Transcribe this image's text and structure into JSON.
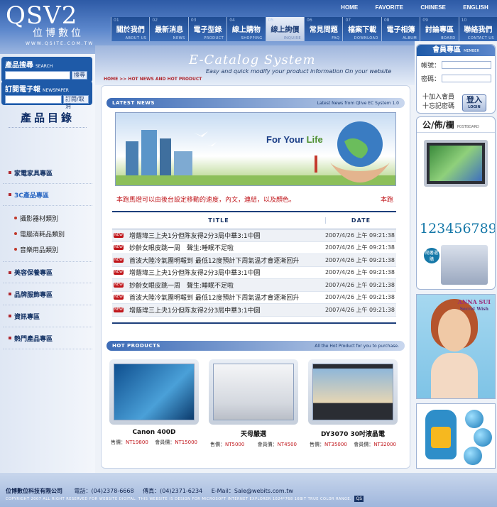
{
  "brand": {
    "logo": "QSV2",
    "logo_cn": "位博數位",
    "url": "WWW.QSITE.COM.TW"
  },
  "top_links": [
    "HOME",
    "FAVORITE",
    "CHINESE",
    "ENGLISH"
  ],
  "nav": [
    {
      "num": "01",
      "label": "關於我們",
      "en": "ABOUT US"
    },
    {
      "num": "02",
      "label": "最新消息",
      "en": "NEWS"
    },
    {
      "num": "03",
      "label": "電子型錄",
      "en": "PRODUCT"
    },
    {
      "num": "04",
      "label": "線上購物",
      "en": "SHOPPING"
    },
    {
      "num": "05",
      "label": "線上詢價",
      "en": "INQUIRE",
      "active": true
    },
    {
      "num": "06",
      "label": "常見問題",
      "en": "FAQ"
    },
    {
      "num": "07",
      "label": "檔案下載",
      "en": "DOWNLOAD"
    },
    {
      "num": "08",
      "label": "電子相簿",
      "en": "ALBUM"
    },
    {
      "num": "09",
      "label": "討論專區",
      "en": "BOARD"
    },
    {
      "num": "10",
      "label": "聯絡我們",
      "en": "CONTACT US"
    }
  ],
  "search": {
    "title": "產品搜尋",
    "title_en": "SEARCH",
    "button": "搜尋"
  },
  "newsletter": {
    "title": "訂閱電子報",
    "title_en": "NEWSPAPER",
    "button": "訂閱/取消"
  },
  "catalog_title": "產品目錄",
  "categories": [
    {
      "label": "家電家具專區",
      "type": "main"
    },
    {
      "label": "3C產品專區",
      "type": "main",
      "accent": true
    },
    {
      "label": "攝影器材類別",
      "type": "sub"
    },
    {
      "label": "電腦消耗品類別",
      "type": "sub"
    },
    {
      "label": "音樂用品類別",
      "type": "sub"
    },
    {
      "label": "美容保養專區",
      "type": "main"
    },
    {
      "label": "品牌服飾專區",
      "type": "main"
    },
    {
      "label": "資訊專區",
      "type": "main"
    },
    {
      "label": "熱門產品專區",
      "type": "main"
    }
  ],
  "banner": {
    "title": "E-Catalog System",
    "subtitle": "Easy and quick modify your product information On your website"
  },
  "breadcrumb": "HOME  >>  HOT NEWS AND HOT PRODUCT",
  "news_section": {
    "title": "LATEST NEWS",
    "right": "Latest News from Qlive EC System 1.0"
  },
  "news_image_text": {
    "a": "For Your ",
    "b": "Life"
  },
  "marquee": {
    "text": "本跑馬燈可以由後台設定移動的速度，內文，連結，以及顏色。",
    "right": "本跑"
  },
  "table": {
    "col_title": "TITLE",
    "col_date": "DATE",
    "badge": "NEW",
    "rows": [
      {
        "title": "增蔭瑋三上夬1分但陈友得2分3局中華3:1中圆",
        "date": "2007/4/26 上午 09:21:38"
      },
      {
        "title": "妙齡女眼皮跳一周　聲生:睡眠不足啦",
        "date": "2007/4/26 上午 09:21:38"
      },
      {
        "title": "首波大陸冷氣團明報到 最低12度預計下周氣溫才會逐漸回升",
        "date": "2007/4/26 上午 09:21:38"
      },
      {
        "title": "增蔭瑋三上夬1分但陈友得2分3局中華3:1中圆",
        "date": "2007/4/26 上午 09:21:38"
      },
      {
        "title": "妙齡女眼皮跳一周　聲生:睡眠不足啦",
        "date": "2007/4/26 上午 09:21:38"
      },
      {
        "title": "首波大陸冷氣團明報到 最低12度預計下周氣溫才會逐漸回升",
        "date": "2007/4/26 上午 09:21:38"
      },
      {
        "title": "增蔭瑋三上夬1分但陈友得2分3局中華3:1中圆",
        "date": "2007/4/26 上午 09:21:38"
      }
    ]
  },
  "hot_section": {
    "title": "HOT PRODUCTS",
    "right": "All the Hot Product for you to purchase."
  },
  "products": [
    {
      "name": "Canon 400D",
      "price_label": "售價：",
      "price": "NT19800",
      "member_label": "會員價：",
      "member_price": "NT15000"
    },
    {
      "name": "天母嚴選",
      "price_label": "售價：",
      "price": "NT5000",
      "member_label": "會員價：",
      "member_price": "NT4500"
    },
    {
      "name": "DY3070 30吋液晶電",
      "price_label": "售價：",
      "price": "NT35000",
      "member_label": "會員價：",
      "member_price": "NT32000"
    }
  ],
  "member": {
    "title": "會員專區",
    "title_en": "MEMBER",
    "account_label": "帳號：",
    "password_label": "密碼：",
    "join": "十加入會員",
    "forgot": "十忘記密碼",
    "login": "登入",
    "login_en": "LOGIN"
  },
  "notice": {
    "title": "公/佈/欄",
    "title_en": "POSTBOARD",
    "number": "123456789",
    "badge": "隨著選購"
  },
  "ad": {
    "brand": "ANNA SUI",
    "sub": "Secret Wish"
  },
  "footer": {
    "company": "位博數位科技有限公司",
    "phone": "電話：(04)2378-6668",
    "fax": "傳真：(04)2371-6234",
    "email": "E-Mail：Sale@webits.com.tw",
    "copyright": "COPYRIGHT 2007 ALL RIGHT RESERVED FOR WEBSITE DIGITAL.     THIS WEBSITE IS DESIGN FOR MICROSOFT INTERNET EXPLORER 1024*768 16BIT TRUE COLOR RANGE.",
    "badge": "QS"
  }
}
